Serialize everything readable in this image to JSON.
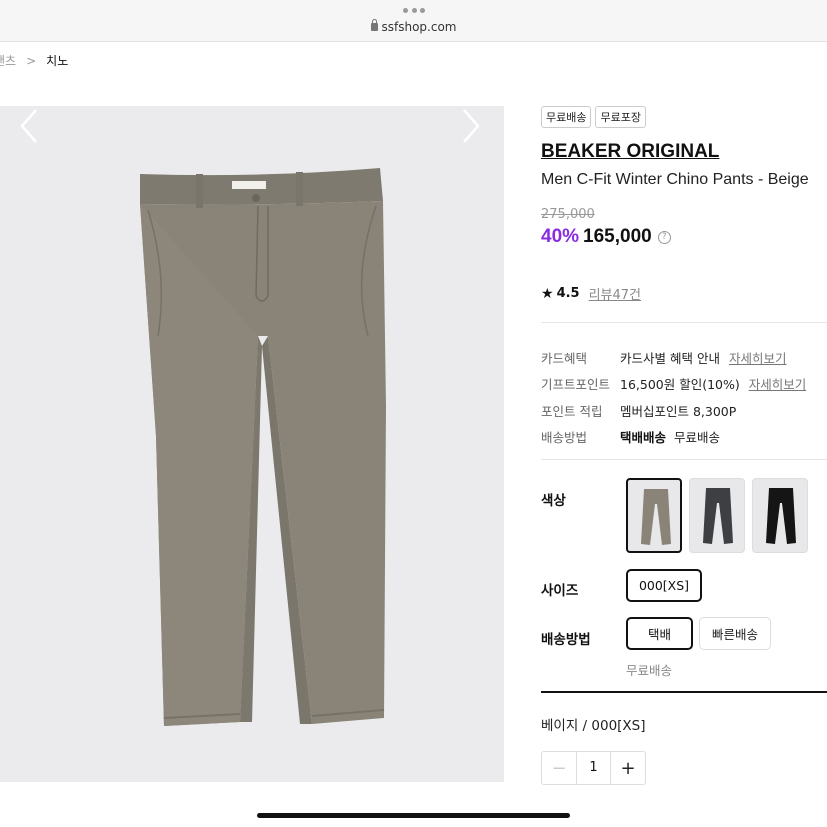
{
  "browser": {
    "url": "ssfshop.com"
  },
  "breadcrumb": {
    "previous": "팬츠",
    "separator": ">",
    "current": "치노"
  },
  "product": {
    "badges": [
      "무료배송",
      "무료포장"
    ],
    "brand": "BEAKER ORIGINAL",
    "name": "Men C-Fit Winter Chino Pants - Beige",
    "original_price": "275,000",
    "discount": "40%",
    "price": "165,000",
    "price_help_icon": "?",
    "rating": {
      "star_icon": "★",
      "value": "4.5",
      "reviews": "리뷰47건"
    }
  },
  "benefits": [
    {
      "key": "카드혜택",
      "value": "카드사별 혜택 안내",
      "link": "자세히보기"
    },
    {
      "key": "기프트포인트",
      "value": "16,500원 할인(10%)",
      "link": "자세히보기"
    },
    {
      "key": "포인트 적립",
      "value": "멤버십포인트 8,300P",
      "link": ""
    },
    {
      "key": "배송방법",
      "value_bold": "택배배송",
      "value": "무료배송",
      "link": ""
    }
  ],
  "options": {
    "color_label": "색상",
    "size_label": "사이즈",
    "delivery_label": "배송방법",
    "colors": [
      {
        "name": "beige",
        "hex": "#8a8478",
        "selected": true
      },
      {
        "name": "charcoal",
        "hex": "#3d3f42",
        "selected": false
      },
      {
        "name": "black",
        "hex": "#151515",
        "selected": false
      }
    ],
    "sizes": [
      {
        "label": "000[XS]",
        "selected": true
      }
    ],
    "delivery_methods": [
      {
        "label": "택배",
        "selected": true
      },
      {
        "label": "빠른배송",
        "selected": false
      }
    ],
    "delivery_note": "무료배송"
  },
  "selection": {
    "summary": "베이지 / 000[XS]",
    "quantity": "1",
    "minus_icon": "−",
    "plus_icon": "+"
  },
  "colors": {
    "accent": "#8a2be2",
    "image_bg": "#ebebed",
    "pants": "#8a8478"
  }
}
